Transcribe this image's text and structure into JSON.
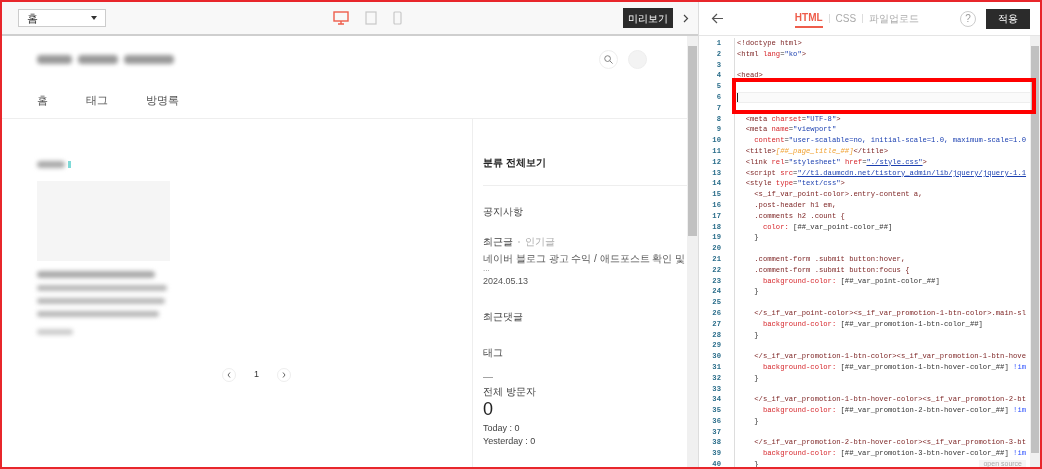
{
  "toolbar": {
    "page_select": {
      "value": "홈"
    },
    "devices": [
      {
        "kind": "desktop",
        "selected": true
      },
      {
        "kind": "tablet",
        "selected": false
      },
      {
        "kind": "mobile",
        "selected": false
      }
    ],
    "preview_button": "미리보기"
  },
  "preview": {
    "nav": [
      "홈",
      "태그",
      "방명록"
    ],
    "pagination": {
      "page": "1"
    },
    "sidebar": {
      "category": "분류 전체보기",
      "notice": "공지사항",
      "recent_tabs": [
        {
          "label": "최근글",
          "selected": true
        },
        {
          "label": "인기글",
          "selected": false
        }
      ],
      "recent_post": {
        "title": "네이버 블로그 광고 수익 / 애드포스트 확인 및",
        "ellipsis": "...",
        "date": "2024.05.13"
      },
      "recent_comments": "최근댓글",
      "tags": "태그",
      "dash": "—",
      "visitors_label": "전체 방문자",
      "visitors_total": "0",
      "today": "Today : 0",
      "yesterday": "Yesterday : 0"
    }
  },
  "editor": {
    "tabs": [
      {
        "label": "HTML",
        "selected": true
      },
      {
        "label": "CSS",
        "selected": false
      },
      {
        "label": "파일업로드",
        "selected": false
      }
    ],
    "help": "?",
    "apply_button": "적용",
    "open_source": "open source",
    "lines": [
      {
        "n": "1",
        "cursor": false,
        "segs": [
          {
            "kind": "tag",
            "text": "<!doctype html>"
          }
        ]
      },
      {
        "n": "2",
        "cursor": false,
        "segs": [
          {
            "kind": "tag",
            "text": "<html "
          },
          {
            "kind": "attr",
            "text": "lang"
          },
          {
            "kind": "plain",
            "text": "="
          },
          {
            "kind": "str",
            "text": "\"ko\""
          },
          {
            "kind": "tag",
            "text": ">"
          }
        ]
      },
      {
        "n": "3",
        "cursor": false
      },
      {
        "n": "4",
        "cursor": false,
        "segs": [
          {
            "kind": "tag",
            "text": "<head>"
          }
        ]
      },
      {
        "n": "5",
        "cursor": false
      },
      {
        "n": "6",
        "cursor": true
      },
      {
        "n": "7",
        "cursor": false
      },
      {
        "n": "8",
        "cursor": false,
        "segs": [
          {
            "kind": "tag",
            "text": "  <meta "
          },
          {
            "kind": "attr",
            "text": "charset"
          },
          {
            "kind": "plain",
            "text": "="
          },
          {
            "kind": "str",
            "text": "\"UTF-8\""
          },
          {
            "kind": "tag",
            "text": ">"
          }
        ]
      },
      {
        "n": "9",
        "cursor": false,
        "segs": [
          {
            "kind": "tag",
            "text": "  <meta "
          },
          {
            "kind": "attr",
            "text": "name"
          },
          {
            "kind": "plain",
            "text": "="
          },
          {
            "kind": "str",
            "text": "\"viewport\""
          }
        ]
      },
      {
        "n": "10",
        "cursor": false,
        "segs": [
          {
            "kind": "attr",
            "text": "    content"
          },
          {
            "kind": "plain",
            "text": "="
          },
          {
            "kind": "str",
            "text": "\"user-scalable=no, initial-scale=1.0, maximum-scale=1.0"
          }
        ]
      },
      {
        "n": "11",
        "cursor": false,
        "segs": [
          {
            "kind": "tag",
            "text": "  <title>"
          },
          {
            "kind": "var",
            "text": "[##_page_title_##]"
          },
          {
            "kind": "tag",
            "text": "</title>"
          }
        ]
      },
      {
        "n": "12",
        "cursor": false,
        "segs": [
          {
            "kind": "tag",
            "text": "  <link "
          },
          {
            "kind": "attr",
            "text": "rel"
          },
          {
            "kind": "plain",
            "text": "="
          },
          {
            "kind": "str",
            "text": "\"stylesheet\" "
          },
          {
            "kind": "attr",
            "text": "href"
          },
          {
            "kind": "plain",
            "text": "="
          },
          {
            "kind": "link",
            "text": "\"./style.css\""
          },
          {
            "kind": "tag",
            "text": ">"
          }
        ]
      },
      {
        "n": "13",
        "cursor": false,
        "segs": [
          {
            "kind": "tag",
            "text": "  <script "
          },
          {
            "kind": "attr",
            "text": "src"
          },
          {
            "kind": "plain",
            "text": "="
          },
          {
            "kind": "link",
            "text": "\"//t1.daumcdn.net/tistory_admin/lib/jquery/jquery-1.1"
          }
        ]
      },
      {
        "n": "14",
        "cursor": false,
        "segs": [
          {
            "kind": "tag",
            "text": "  <style "
          },
          {
            "kind": "attr",
            "text": "type"
          },
          {
            "kind": "plain",
            "text": "="
          },
          {
            "kind": "str",
            "text": "\"text/css\""
          },
          {
            "kind": "tag",
            "text": ">"
          }
        ]
      },
      {
        "n": "15",
        "cursor": false,
        "segs": [
          {
            "kind": "tag",
            "text": "    <s_if_var_point-color>.entry-content a,"
          }
        ]
      },
      {
        "n": "16",
        "cursor": false,
        "segs": [
          {
            "kind": "tag",
            "text": "    .post-header h1 em,"
          }
        ]
      },
      {
        "n": "17",
        "cursor": false,
        "segs": [
          {
            "kind": "tag",
            "text": "    .comments h2 .count {"
          }
        ]
      },
      {
        "n": "18",
        "cursor": false,
        "segs": [
          {
            "kind": "attr",
            "text": "      color:"
          },
          {
            "kind": "plain",
            "text": " [##_var_point-color_##]"
          }
        ]
      },
      {
        "n": "19",
        "cursor": false,
        "segs": [
          {
            "kind": "plain",
            "text": "    }"
          }
        ]
      },
      {
        "n": "20",
        "cursor": false
      },
      {
        "n": "21",
        "cursor": false,
        "segs": [
          {
            "kind": "tag",
            "text": "    .comment-form .submit button:hover,"
          }
        ]
      },
      {
        "n": "22",
        "cursor": false,
        "segs": [
          {
            "kind": "tag",
            "text": "    .comment-form .submit button:focus {"
          }
        ]
      },
      {
        "n": "23",
        "cursor": false,
        "segs": [
          {
            "kind": "attr",
            "text": "      background-color:"
          },
          {
            "kind": "plain",
            "text": " [##_var_point-color_##]"
          }
        ]
      },
      {
        "n": "24",
        "cursor": false,
        "segs": [
          {
            "kind": "plain",
            "text": "    }"
          }
        ]
      },
      {
        "n": "25",
        "cursor": false
      },
      {
        "n": "26",
        "cursor": false,
        "segs": [
          {
            "kind": "tag",
            "text": "    </s_if_var_point-color><s_if_var_promotion-1-btn-color>.main-sl"
          }
        ]
      },
      {
        "n": "27",
        "cursor": false,
        "segs": [
          {
            "kind": "attr",
            "text": "      background-color:"
          },
          {
            "kind": "plain",
            "text": " [##_var_promotion-1-btn-color_##]"
          }
        ]
      },
      {
        "n": "28",
        "cursor": false,
        "segs": [
          {
            "kind": "plain",
            "text": "    }"
          }
        ]
      },
      {
        "n": "29",
        "cursor": false
      },
      {
        "n": "30",
        "cursor": false,
        "segs": [
          {
            "kind": "tag",
            "text": "    </s_if_var_promotion-1-btn-color><s_if_var_promotion-1-btn-hove"
          }
        ]
      },
      {
        "n": "31",
        "cursor": false,
        "segs": [
          {
            "kind": "attr",
            "text": "      background-color:"
          },
          {
            "kind": "plain",
            "text": " [##_var_promotion-1-btn-hover-color_##]"
          },
          {
            "kind": "imp",
            "text": " !im"
          }
        ]
      },
      {
        "n": "32",
        "cursor": false,
        "segs": [
          {
            "kind": "plain",
            "text": "    }"
          }
        ]
      },
      {
        "n": "33",
        "cursor": false
      },
      {
        "n": "34",
        "cursor": false,
        "segs": [
          {
            "kind": "tag",
            "text": "    </s_if_var_promotion-1-btn-hover-color><s_if_var_promotion-2-bt"
          }
        ]
      },
      {
        "n": "35",
        "cursor": false,
        "segs": [
          {
            "kind": "attr",
            "text": "      background-color:"
          },
          {
            "kind": "plain",
            "text": " [##_var_promotion-2-btn-hover-color_##]"
          },
          {
            "kind": "imp",
            "text": " !im"
          }
        ]
      },
      {
        "n": "36",
        "cursor": false,
        "segs": [
          {
            "kind": "plain",
            "text": "    }"
          }
        ]
      },
      {
        "n": "37",
        "cursor": false
      },
      {
        "n": "38",
        "cursor": false,
        "segs": [
          {
            "kind": "tag",
            "text": "    </s_if_var_promotion-2-btn-hover-color><s_if_var_promotion-3-bt"
          }
        ]
      },
      {
        "n": "39",
        "cursor": false,
        "segs": [
          {
            "kind": "attr",
            "text": "      background-color:"
          },
          {
            "kind": "plain",
            "text": " [##_var_promotion-3-btn-hover-color_##]"
          },
          {
            "kind": "imp",
            "text": " !im"
          }
        ]
      },
      {
        "n": "40",
        "cursor": false,
        "segs": [
          {
            "kind": "plain",
            "text": "    }"
          }
        ]
      }
    ]
  }
}
